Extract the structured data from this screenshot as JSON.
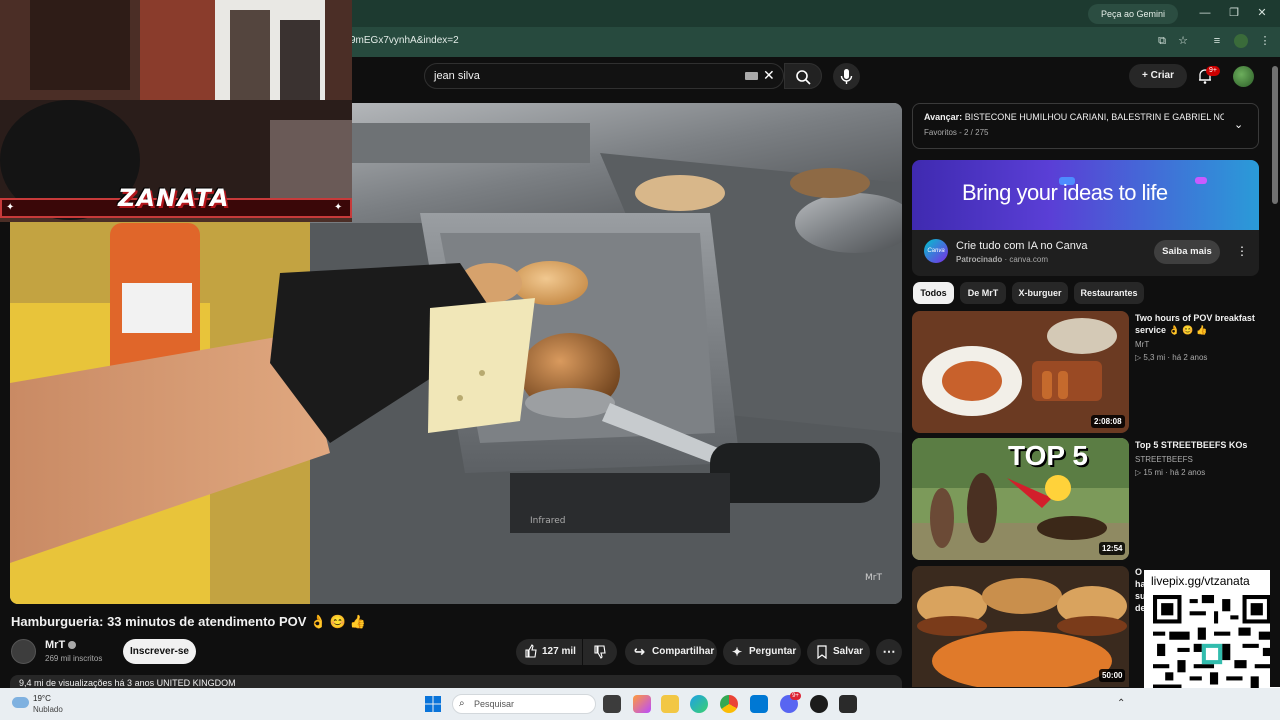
{
  "browser": {
    "gemini_label": "Peça ao Gemini",
    "url": "9mEGx7vynhA&index=2",
    "window_controls": [
      "—",
      "❐",
      "✕"
    ]
  },
  "header": {
    "search_query": "jean silva",
    "create_label": "Criar",
    "notifications": "9+"
  },
  "webcam": {
    "streamer_logo": "ZANATA"
  },
  "video": {
    "title": "Hamburgueria: 33 minutos de atendimento POV 👌 😊 👍",
    "watermark": "MrT",
    "griddle_brand": "Infrared",
    "channel": "MrT",
    "subscribers": "269 mil inscritos",
    "subscribe_label": "Inscrever-se",
    "likes": "127 mil",
    "share_label": "Compartilhar",
    "ask_label": "Perguntar",
    "save_label": "Salvar",
    "description_peek": "9,4 mi de visualizações  há 3 anos  UNITED KINGDOM"
  },
  "playlist": {
    "next_label": "Avançar:",
    "next_title": "BISTECONE HUMILHOU CARIANI, BALESTRIN E GABRIEL NO...",
    "sub": "Favoritos - 2 / 275"
  },
  "ad": {
    "headline": "Bring your ideas to life",
    "title": "Crie tudo com IA no Canva",
    "sponsor": "Patrocinado",
    "domain": "canva.com",
    "cta": "Saiba mais",
    "logo_text": "Canva"
  },
  "chips": [
    "Todos",
    "De MrT",
    "X-burguer",
    "Restaurantes"
  ],
  "related": [
    {
      "title": "Two hours of POV breakfast service 👌 😊 👍",
      "channel": "MrT",
      "views": "5,3 mi",
      "age": "há 2 anos",
      "duration": "2:08:08"
    },
    {
      "title": "Top 5 STREETBEEFS KOs",
      "channel": "STREETBEEFS",
      "views": "15 mi",
      "age": "há 2 anos",
      "duration": "12:54",
      "thumb_text": "TOP 5"
    },
    {
      "title": "O hambúrguer suculento de...",
      "channel": "",
      "views": "",
      "age": "",
      "duration": "50:00"
    }
  ],
  "livepix": {
    "text": "livepix.gg/vtzanata"
  },
  "taskbar": {
    "temp": "19°C",
    "weather": "Nublado",
    "search_placeholder": "Pesquisar",
    "discord_badge": "9+"
  },
  "colors": {
    "chrome_green": "#1d3a30",
    "yt_bg": "#0f0f0f",
    "yt_red": "#cc0000",
    "zanata_red": "#b3161b"
  }
}
